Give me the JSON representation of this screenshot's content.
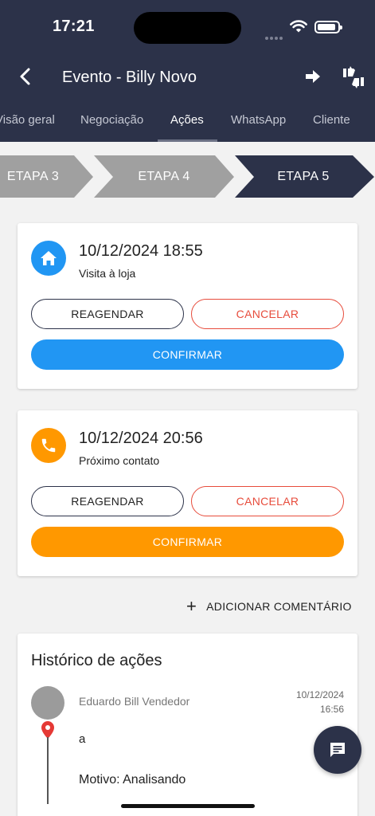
{
  "status_bar": {
    "time": "17:21"
  },
  "header": {
    "title": "Evento - Billy Novo"
  },
  "tabs": [
    {
      "label": "Visão geral"
    },
    {
      "label": "Negociação"
    },
    {
      "label": "Ações"
    },
    {
      "label": "WhatsApp"
    },
    {
      "label": "Cliente"
    }
  ],
  "active_tab": "Ações",
  "steps": [
    {
      "label": "ETAPA 3"
    },
    {
      "label": "ETAPA 4"
    },
    {
      "label": "ETAPA 5"
    }
  ],
  "active_step": "ETAPA 5",
  "events": [
    {
      "datetime": "10/12/2024 18:55",
      "type": "Visita à loja",
      "icon": "home-icon",
      "color": "#2196f3",
      "reschedule_label": "REAGENDAR",
      "cancel_label": "CANCELAR",
      "confirm_label": "CONFIRMAR"
    },
    {
      "datetime": "10/12/2024 20:56",
      "type": "Próximo contato",
      "icon": "phone-icon",
      "color": "#ff9800",
      "reschedule_label": "REAGENDAR",
      "cancel_label": "CANCELAR",
      "confirm_label": "CONFIRMAR"
    }
  ],
  "add_comment": {
    "label": "ADICIONAR COMENTÁRIO"
  },
  "history": {
    "title": "Histórico de ações",
    "items": [
      {
        "author": "Eduardo Bill Vendedor",
        "date": "10/12/2024",
        "time": "16:56",
        "text": "a",
        "reason": "Motivo: Analisando"
      }
    ]
  },
  "colors": {
    "header_bg": "#2c3249",
    "step_inactive": "#a0a0a0",
    "step_active": "#2c3249",
    "cancel": "#e74c3c"
  }
}
